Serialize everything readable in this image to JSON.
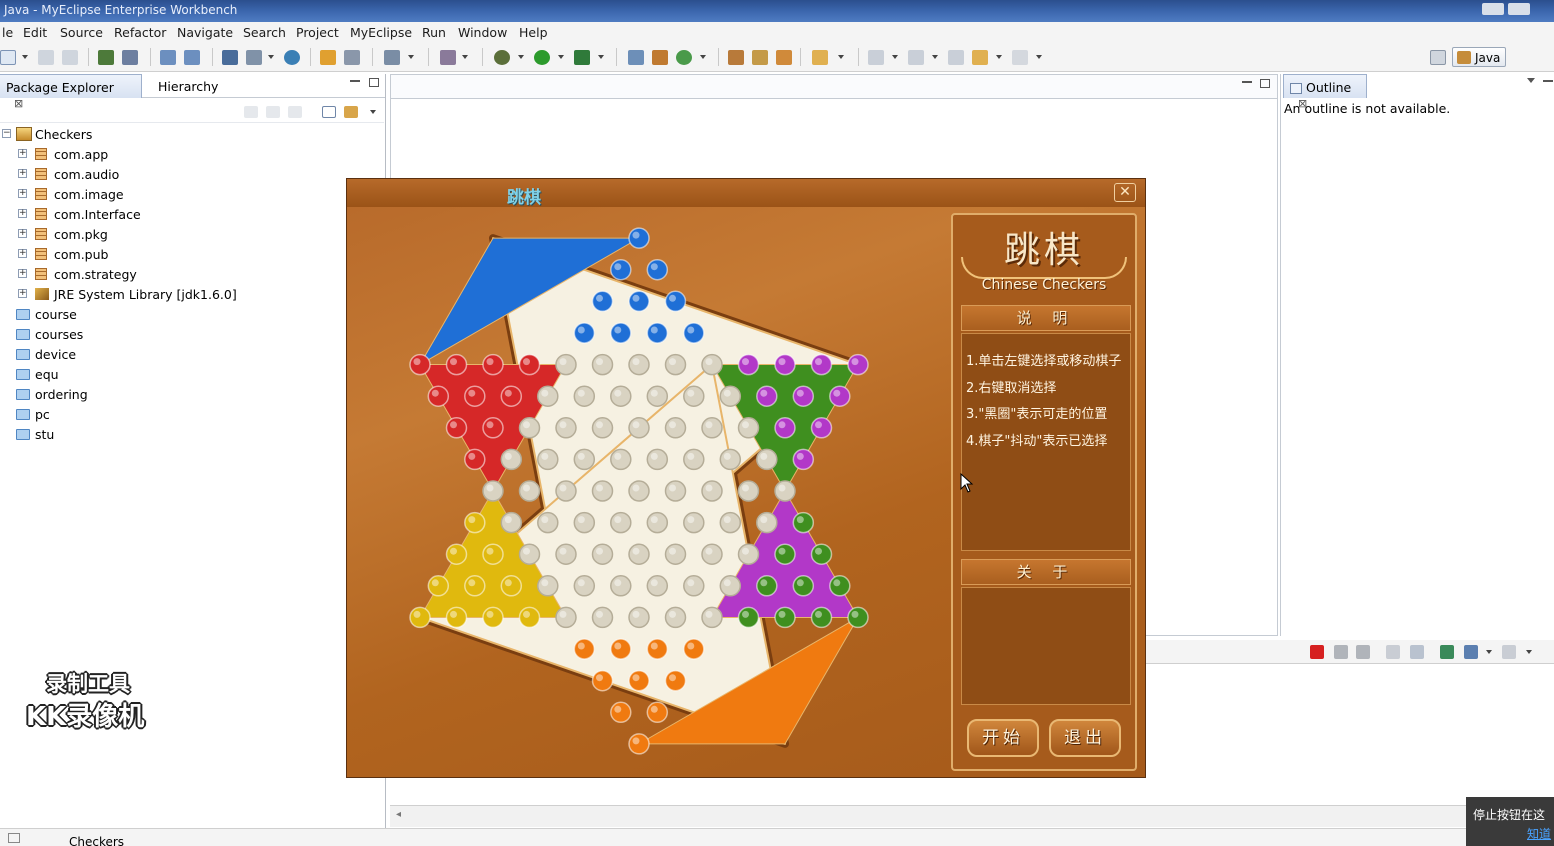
{
  "window": {
    "title": "Java - MyEclipse Enterprise Workbench"
  },
  "menu": [
    "le",
    "Edit",
    "Source",
    "Refactor",
    "Navigate",
    "Search",
    "Project",
    "MyEclipse",
    "Run",
    "Window",
    "Help"
  ],
  "perspective": {
    "label": "Java"
  },
  "left_panel": {
    "tabs": [
      {
        "label": "Package Explorer",
        "close": "⊠"
      },
      {
        "label": "Hierarchy"
      }
    ],
    "tree": [
      {
        "label": "Checkers",
        "icon": "project-icon",
        "level": 0
      },
      {
        "label": "com.app",
        "icon": "package-icon",
        "level": 1
      },
      {
        "label": "com.audio",
        "icon": "package-icon",
        "level": 1
      },
      {
        "label": "com.image",
        "icon": "package-icon",
        "level": 1
      },
      {
        "label": "com.Interface",
        "icon": "package-icon",
        "level": 1
      },
      {
        "label": "com.pkg",
        "icon": "package-icon",
        "level": 1
      },
      {
        "label": "com.pub",
        "icon": "package-icon",
        "level": 1
      },
      {
        "label": "com.strategy",
        "icon": "package-icon",
        "level": 1
      },
      {
        "label": "JRE System Library [jdk1.6.0]",
        "icon": "library-icon",
        "level": 1
      },
      {
        "label": "course",
        "icon": "folder-icon",
        "level": 0
      },
      {
        "label": "courses",
        "icon": "folder-icon",
        "level": 0
      },
      {
        "label": "device",
        "icon": "folder-icon",
        "level": 0
      },
      {
        "label": "equ",
        "icon": "folder-icon",
        "level": 0
      },
      {
        "label": "ordering",
        "icon": "folder-icon",
        "level": 0
      },
      {
        "label": "pc",
        "icon": "folder-icon",
        "level": 0
      },
      {
        "label": "stu",
        "icon": "folder-icon",
        "level": 0
      }
    ]
  },
  "outline": {
    "tab": "Outline",
    "message": "An outline is not available."
  },
  "status": {
    "text": "Checkers"
  },
  "watermark": {
    "line1": "录制工具",
    "line2": "KK录像机"
  },
  "notice": {
    "line1": "停止按钮在这",
    "line2": "知道"
  },
  "game": {
    "title": "跳棋",
    "side_title": "跳棋",
    "side_subtitle": "Chinese Checkers",
    "instructions_heading": "说 明",
    "instructions": [
      "1.单击左键选择或移动棋子",
      "2.右键取消选择",
      "3.\"黑圈\"表示可走的位置",
      "4.棋子\"抖动\"表示已选择"
    ],
    "about_heading": "关 于",
    "start_label": "开始",
    "exit_label": "退出",
    "colors": {
      "top": "#1f6fd6",
      "top_left": "#d62828",
      "top_right": "#b238c8",
      "bottom_left": "#e0b90e",
      "bottom_right": "#3f8f1f",
      "bottom": "#f07a10",
      "empty": "#d9d3c2",
      "center": "#f6f1e2"
    }
  }
}
